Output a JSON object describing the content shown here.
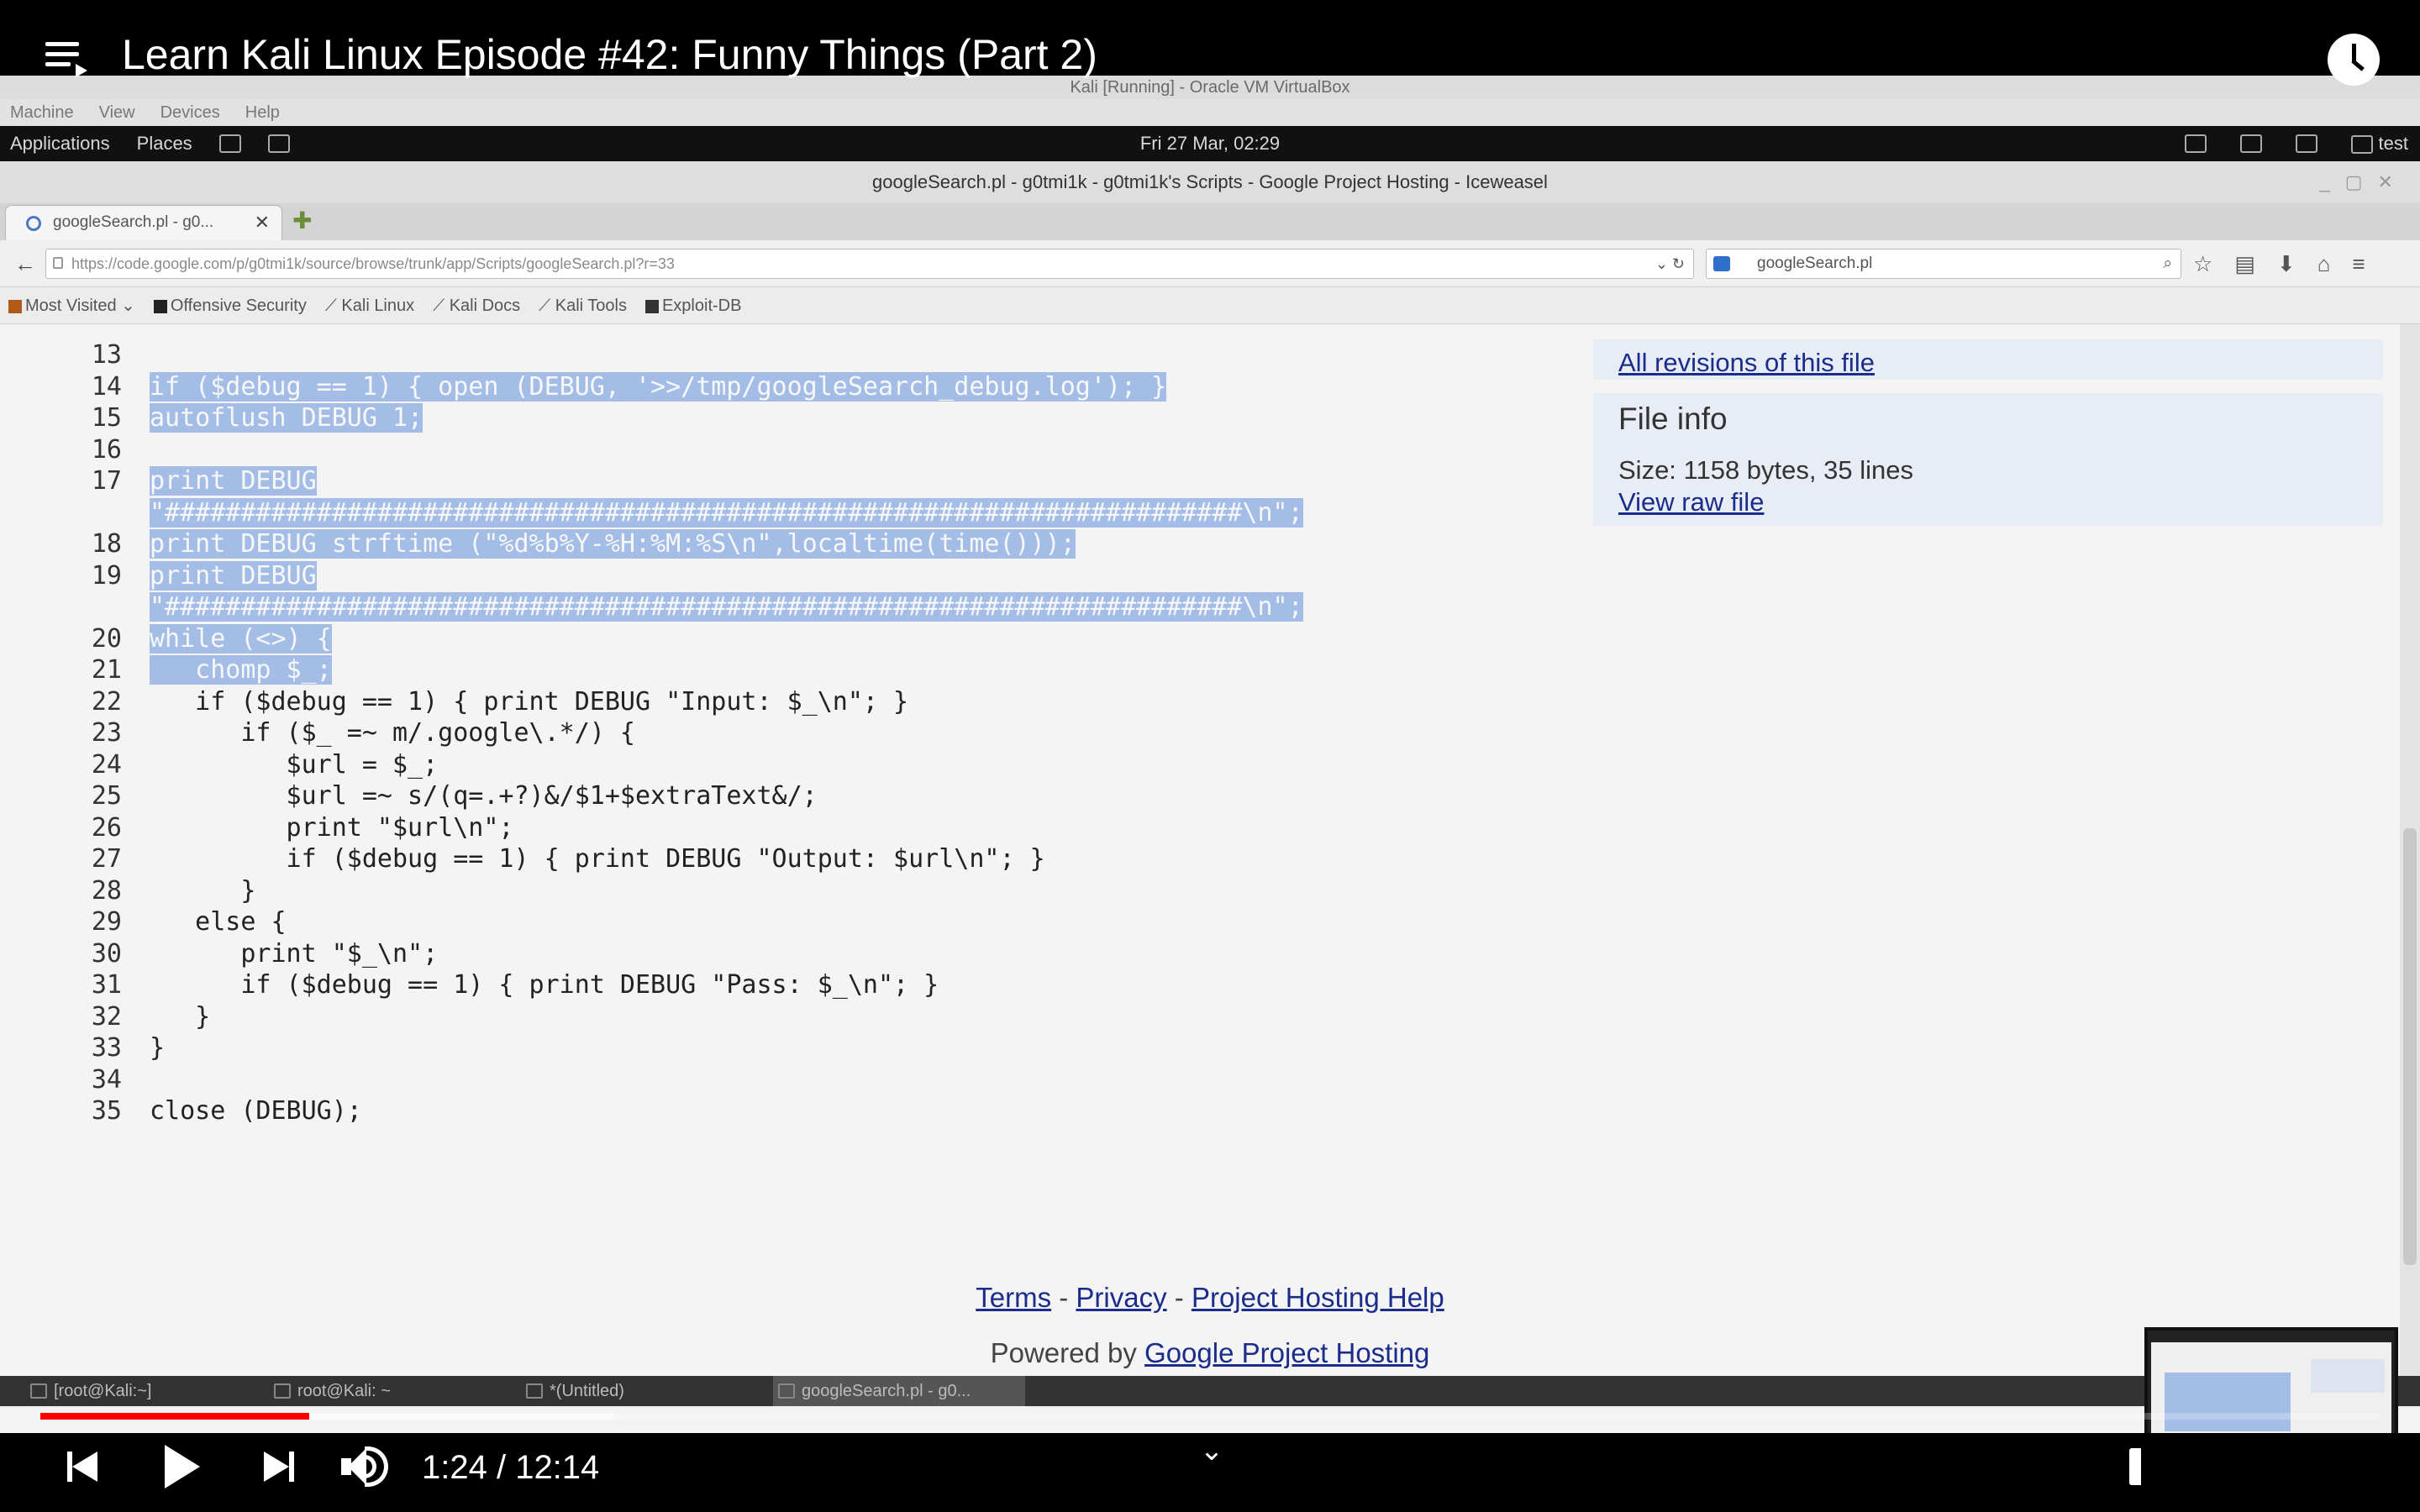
{
  "youtube": {
    "title": "Learn Kali Linux Episode #42: Funny Things (Part 2)",
    "time_display": "1:24 / 12:14",
    "progress": {
      "played_fraction": 0.115,
      "buffered_fraction": 0.245
    }
  },
  "vm": {
    "vbox_title": "Kali [Running] - Oracle VM VirtualBox",
    "vbox_menu": [
      "Machine",
      "View",
      "Devices",
      "Help"
    ],
    "gnome": {
      "applications": "Applications",
      "places": "Places",
      "clock": "Fri 27 Mar, 02:29",
      "user": "test"
    },
    "browser": {
      "window_title": "googleSearch.pl - g0tmi1k - g0tmi1k's Scripts - Google Project Hosting - Iceweasel",
      "tab_label": "googleSearch.pl - g0...",
      "url": "https://code.google.com/p/g0tmi1k/source/browse/trunk/app/Scripts/googleSearch.pl?r=33",
      "search_value": "googleSearch.pl",
      "bookmarks": [
        "Most Visited",
        "Offensive Security",
        "Kali Linux",
        "Kali Docs",
        "Kali Tools",
        "Exploit-DB"
      ]
    },
    "page": {
      "code_lines": [
        {
          "n": "13",
          "text": "",
          "sel": true
        },
        {
          "n": "14",
          "text": "if ($debug == 1) { open (DEBUG, '>>/tmp/googleSearch_debug.log'); }",
          "sel": true
        },
        {
          "n": "15",
          "text": "autoflush DEBUG 1;",
          "sel": true
        },
        {
          "n": "16",
          "text": "",
          "sel": true
        },
        {
          "n": "17",
          "text": "print DEBUG",
          "sel": true
        },
        {
          "n": "",
          "text": "\"#######################################################################\\n\";",
          "sel": true
        },
        {
          "n": "18",
          "text": "print DEBUG strftime (\"%d%b%Y-%H:%M:%S\\n\",localtime(time()));",
          "sel": true
        },
        {
          "n": "19",
          "text": "print DEBUG",
          "sel": true
        },
        {
          "n": "",
          "text": "\"#######################################################################\\n\";",
          "sel": true
        },
        {
          "n": "20",
          "text": "while (<>) {",
          "sel": true
        },
        {
          "n": "21",
          "text": "   chomp $_;",
          "sel": true
        },
        {
          "n": "22",
          "text": "   if ($debug == 1) { print DEBUG \"Input: $_\\n\"; }",
          "sel": false
        },
        {
          "n": "23",
          "text": "      if ($_ =~ m/.google\\.*/) {",
          "sel": false
        },
        {
          "n": "24",
          "text": "         $url = $_;",
          "sel": false
        },
        {
          "n": "25",
          "text": "         $url =~ s/(q=.+?)&/$1+$extraText&/;",
          "sel": false
        },
        {
          "n": "26",
          "text": "         print \"$url\\n\";",
          "sel": false
        },
        {
          "n": "27",
          "text": "         if ($debug == 1) { print DEBUG \"Output: $url\\n\"; }",
          "sel": false
        },
        {
          "n": "28",
          "text": "      }",
          "sel": false
        },
        {
          "n": "29",
          "text": "   else {",
          "sel": false
        },
        {
          "n": "30",
          "text": "      print \"$_\\n\";",
          "sel": false
        },
        {
          "n": "31",
          "text": "      if ($debug == 1) { print DEBUG \"Pass: $_\\n\"; }",
          "sel": false
        },
        {
          "n": "32",
          "text": "   }",
          "sel": false
        },
        {
          "n": "33",
          "text": "}",
          "sel": false
        },
        {
          "n": "34",
          "text": "",
          "sel": false
        },
        {
          "n": "35",
          "text": "close (DEBUG);",
          "sel": false
        }
      ],
      "all_revisions_link": "All revisions of this file",
      "file_info_title": "File info",
      "file_info_size": "Size: 1158 bytes, 35 lines",
      "view_raw_link": "View raw file",
      "footer": {
        "terms": "Terms",
        "privacy": "Privacy",
        "help": "Project Hosting Help",
        "sep": " - ",
        "powered_by": "Powered by ",
        "powered_link": "Google Project Hosting"
      }
    },
    "taskbar": [
      "[root@Kali:~]",
      "root@Kali: ~",
      "*(Untitled)",
      "googleSearch.pl - g0..."
    ]
  }
}
